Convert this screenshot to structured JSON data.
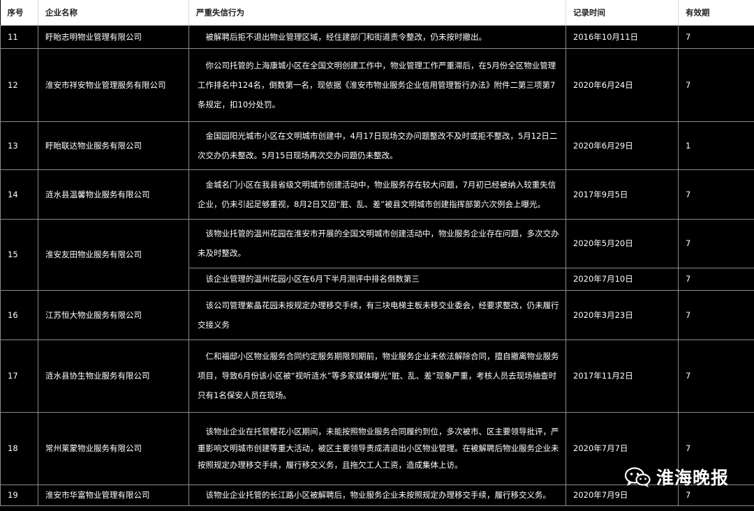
{
  "headers": {
    "no": "序号",
    "company": "企业名称",
    "behavior": "严重失信行为",
    "date": "记录时间",
    "validity": "有效期"
  },
  "rows": [
    {
      "no": "11",
      "company": "盱眙志明物业管理有限公司",
      "entries": [
        {
          "behavior": "被解聘后拒不退出物业管理区域，经住建部门和街道责令整改，仍未按时撤出。",
          "date": "2016年10月11日",
          "validity": "7"
        }
      ]
    },
    {
      "no": "12",
      "company": "淮安市祥安物业管理服务有限公司",
      "entries": [
        {
          "behavior": "你公司托管的上海康城小区在全国文明创建工作中，物业管理工作严重滞后，在5月份全区物业管理工作排名中124名，倒数第一名，现依据《淮安市物业服务企业信用管理暂行办法》附件二第三项第7条规定，扣10分处罚。",
          "date": "2020年6月24日",
          "validity": "7"
        }
      ]
    },
    {
      "no": "13",
      "company": "盱眙联达物业服务有限公司",
      "entries": [
        {
          "behavior": "金国园阳光城市小区在文明城市创建中，4月17日现场交办问题整改不及时或拒不整改，5月12日二次交办仍未整改。5月15日现场再次交办问题仍未整改。",
          "date": "2020年6月29日",
          "validity": "1"
        }
      ]
    },
    {
      "no": "14",
      "company": "涟水县温馨物业服务有限公司",
      "entries": [
        {
          "behavior": "金城名门小区在我县省级文明城市创建活动中，物业服务存在较大问题，7月初已经被纳入较重失信企业，仍未引起足够重视，8月2日又因“脏、乱、差”被县文明城市创建指挥部第六次例会上曝光。",
          "date": "2017年9月5日",
          "validity": "7"
        }
      ]
    },
    {
      "no": "15",
      "company": "淮安友田物业服务有限公司",
      "entries": [
        {
          "behavior": "该物业托管的温州花园在淮安市开展的全国文明城市创建活动中，物业服务企业存在问题，多次交办未及时整改。",
          "date": "2020年5月20日",
          "validity": "7"
        },
        {
          "behavior": "该企业管理的温州花园小区在6月下半月测评中排名倒数第三",
          "date": "2020年7月10日",
          "validity": "7"
        }
      ]
    },
    {
      "no": "16",
      "company": "江苏恒大物业服务有限公司",
      "entries": [
        {
          "behavior": "该公司管理紫晶花园未按规定办理移交手续，有三块电梯主板未移交业委会，经要求整改，仍未履行交接义务",
          "date": "2020年3月23日",
          "validity": "7"
        }
      ]
    },
    {
      "no": "17",
      "company": "涟水县协生物业服务有限公司",
      "entries": [
        {
          "behavior": "仁和福邸小区物业服务合同约定服务期限到期前，物业服务企业未依法解除合同，擅自撤离物业服务项目，导致6月份该小区被“视听涟水”等多家媒体曝光“脏、乱、差”现象严重，考核人员去现场抽查时只有1名保安人员在现场。",
          "date": "2017年11月2日",
          "validity": "7"
        }
      ]
    },
    {
      "no": "18",
      "company": "常州莱蒙物业服务有限公司",
      "entries": [
        {
          "behavior": "该物业企业在托管樱花小区期间，未能按照物业服务合同履约到位，多次被市、区主要领导批评，严重影响文明城市创建等重大活动，被区主要领导责成清退出小区物业管理。在被解聘后物业服务企业未按照规定办理移交手续，履行移交义务，且拖欠工人工资，造成集体上访。",
          "date": "2020年7月7日",
          "validity": "7"
        }
      ]
    },
    {
      "no": "19",
      "company": "淮安市华富物业管理有限公司",
      "entries": [
        {
          "behavior": "该物业企业托管的长江路小区被解聘后，物业服务企业未按照规定办理移交手续，履行移交义务。",
          "date": "2020年7月9日",
          "validity": "7"
        }
      ]
    }
  ],
  "watermark": {
    "icon": "wechat-icon",
    "text": "淮海晚报"
  }
}
